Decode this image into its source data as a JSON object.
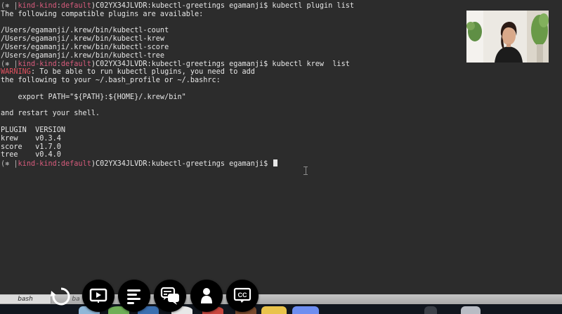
{
  "terminal": {
    "lines": [
      {
        "parts": [
          {
            "t": "(⎈ |",
            "c": "dim"
          },
          {
            "t": "kind-kind",
            "c": "pink"
          },
          {
            "t": ":",
            "c": "dim"
          },
          {
            "t": "default",
            "c": "pink"
          },
          {
            "t": ")C02YX34JLVDR:kubectl-greetings egamanji$ kubectl plugin list",
            "c": ""
          }
        ]
      },
      {
        "parts": [
          {
            "t": "The following compatible plugins are available:",
            "c": ""
          }
        ]
      },
      {
        "parts": [
          {
            "t": "",
            "c": ""
          }
        ]
      },
      {
        "parts": [
          {
            "t": "/Users/egamanji/.krew/bin/kubectl-count",
            "c": ""
          }
        ]
      },
      {
        "parts": [
          {
            "t": "/Users/egamanji/.krew/bin/kubectl-krew",
            "c": ""
          }
        ]
      },
      {
        "parts": [
          {
            "t": "/Users/egamanji/.krew/bin/kubectl-score",
            "c": ""
          }
        ]
      },
      {
        "parts": [
          {
            "t": "/Users/egamanji/.krew/bin/kubectl-tree",
            "c": ""
          }
        ]
      },
      {
        "parts": [
          {
            "t": "(⎈ |",
            "c": "dim"
          },
          {
            "t": "kind-kind",
            "c": "pink"
          },
          {
            "t": ":",
            "c": "dim"
          },
          {
            "t": "default",
            "c": "pink"
          },
          {
            "t": ")C02YX34JLVDR:kubectl-greetings egamanji$ kubectl krew  list",
            "c": ""
          }
        ]
      },
      {
        "parts": [
          {
            "t": "WARNING",
            "c": "red"
          },
          {
            "t": ": To be able to run kubectl plugins, you need to add",
            "c": ""
          }
        ]
      },
      {
        "parts": [
          {
            "t": "the following to your ~/.bash_profile or ~/.bashrc:",
            "c": ""
          }
        ]
      },
      {
        "parts": [
          {
            "t": "",
            "c": ""
          }
        ]
      },
      {
        "parts": [
          {
            "t": "    export PATH=\"${PATH}:${HOME}/.krew/bin\"",
            "c": ""
          }
        ]
      },
      {
        "parts": [
          {
            "t": "",
            "c": ""
          }
        ]
      },
      {
        "parts": [
          {
            "t": "and restart your shell.",
            "c": ""
          }
        ]
      },
      {
        "parts": [
          {
            "t": "",
            "c": ""
          }
        ]
      },
      {
        "parts": [
          {
            "t": "PLUGIN  VERSION",
            "c": ""
          }
        ]
      },
      {
        "parts": [
          {
            "t": "krew    v0.3.4",
            "c": ""
          }
        ]
      },
      {
        "parts": [
          {
            "t": "score   v1.7.0",
            "c": ""
          }
        ]
      },
      {
        "parts": [
          {
            "t": "tree    v0.4.0",
            "c": ""
          }
        ]
      },
      {
        "parts": [
          {
            "t": "(⎈ |",
            "c": "dim"
          },
          {
            "t": "kind-kind",
            "c": "pink"
          },
          {
            "t": ":",
            "c": "dim"
          },
          {
            "t": "default",
            "c": "pink"
          },
          {
            "t": ")C02YX34JLVDR:kubectl-greetings egamanji$ ",
            "c": ""
          }
        ],
        "cursor": true
      }
    ]
  },
  "tabs": [
    {
      "name": "tab-bash-1",
      "label": "bash"
    },
    {
      "name": "tab-bash-2",
      "label": "ba"
    }
  ],
  "player_controls": [
    {
      "name": "slides-control-button",
      "icon": "presentation-icon"
    },
    {
      "name": "transcript-control-button",
      "icon": "text-lines-icon"
    },
    {
      "name": "chat-control-button",
      "icon": "chat-bubbles-icon"
    },
    {
      "name": "speaker-control-button",
      "icon": "person-icon"
    },
    {
      "name": "captions-control-button",
      "icon": "cc-icon",
      "label": "CC"
    }
  ],
  "colors": {
    "terminal_bg": "#2c2c2c",
    "prompt_context": "#d75b7c",
    "warning": "#e0505e",
    "text": "#e6e6e6",
    "control_bg": "#000000"
  }
}
